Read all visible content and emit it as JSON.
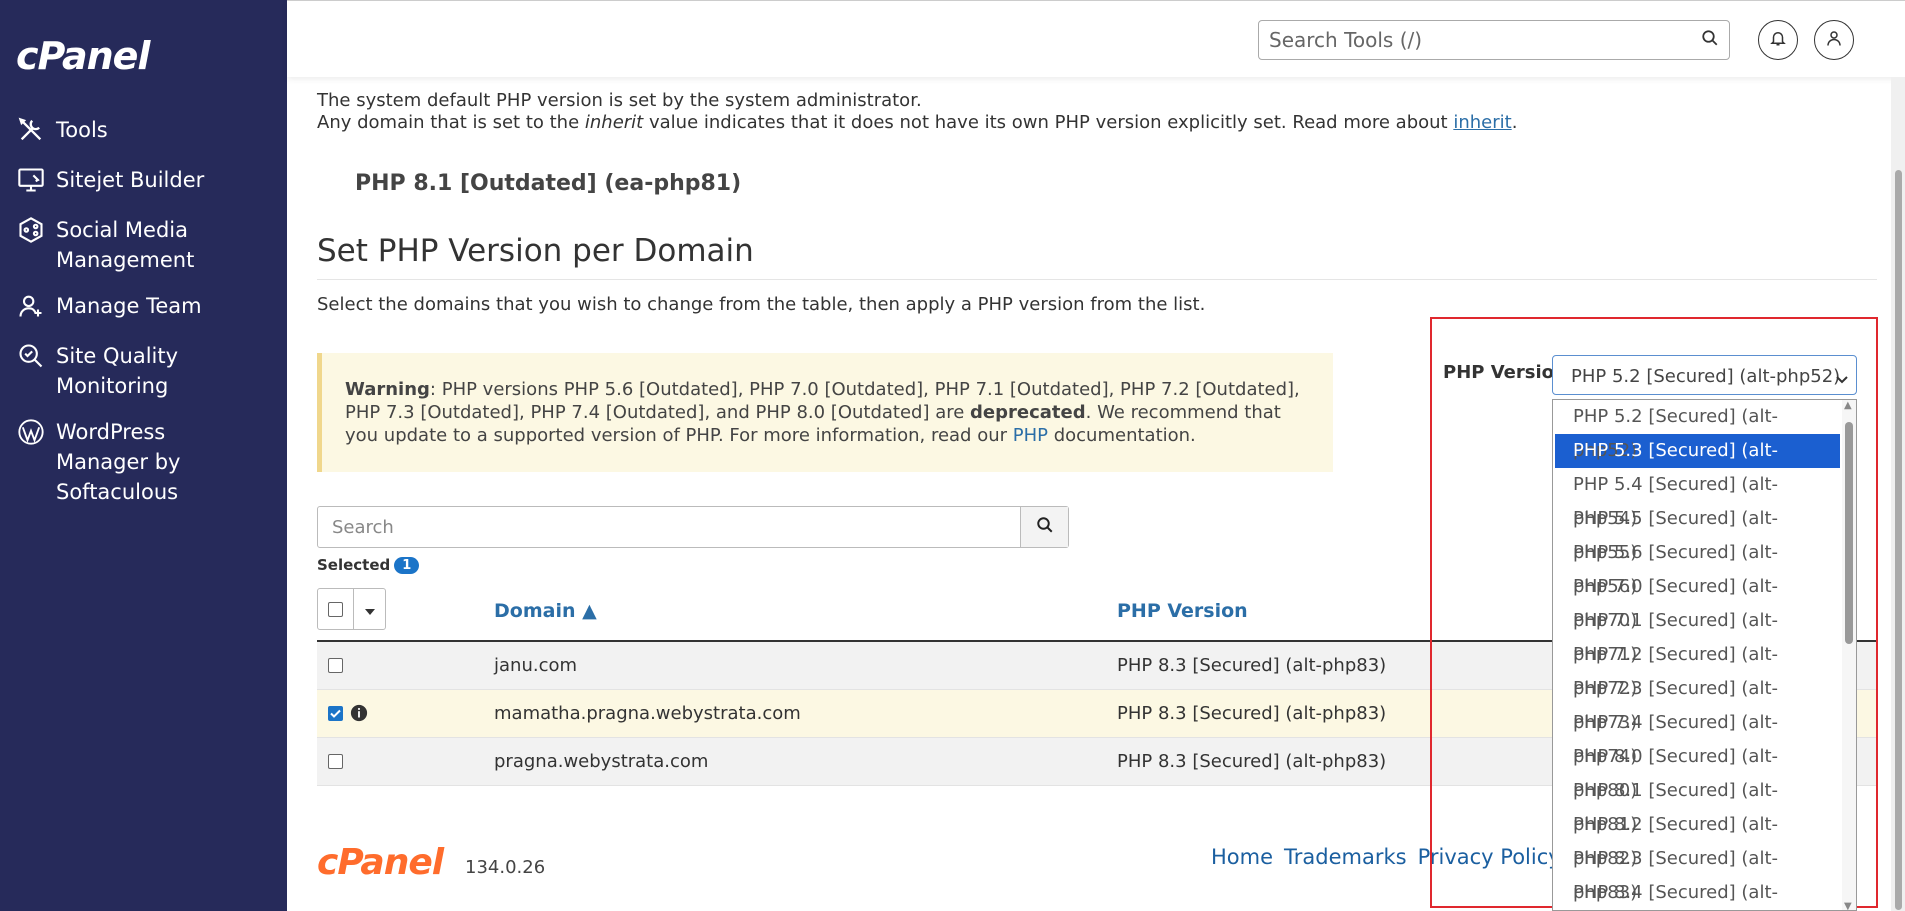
{
  "sidebar": {
    "logo": "cPanel",
    "items": [
      {
        "label": "Tools",
        "icon": "tools-icon"
      },
      {
        "label": "Sitejet Builder",
        "icon": "monitor-icon"
      },
      {
        "label": "Social Media Management",
        "icon": "social-icon"
      },
      {
        "label": "Manage Team",
        "icon": "team-icon"
      },
      {
        "label": "Site Quality Monitoring",
        "icon": "magnifier-icon"
      },
      {
        "label": "WordPress Manager by Softaculous",
        "icon": "wordpress-icon"
      }
    ]
  },
  "topbar": {
    "search_placeholder": "Search Tools (/)",
    "icons": [
      "search-icon",
      "bell-icon",
      "user-icon"
    ]
  },
  "intro": {
    "line1": "The system default PHP version is set by the system administrator.",
    "line2_a": "Any domain that is set to the ",
    "line2_em": "inherit",
    "line2_b": " value indicates that it does not have its own PHP version explicitly set. Read more about ",
    "line2_link": "inherit",
    "line2_end": "."
  },
  "current_version": "PHP 8.1 [Outdated] (ea-php81)",
  "section": {
    "title": "Set PHP Version per Domain",
    "description": "Select the domains that you wish to change from the table, then apply a PHP version from the list."
  },
  "warning": {
    "label": "Warning",
    "text_a": ": PHP versions PHP 5.6 [Outdated], PHP 7.0 [Outdated], PHP 7.1 [Outdated], PHP 7.2 [Outdated], PHP 7.3 [Outdated], PHP 7.4 [Outdated], and PHP 8.0 [Outdated] are ",
    "bold": "deprecated",
    "text_b": ". We recommend that you update to a supported version of PHP. For more information, read our ",
    "link": "PHP",
    "text_c": " documentation."
  },
  "table": {
    "search_placeholder": "Search",
    "selected_label": "Selected",
    "selected_count": "1",
    "columns": {
      "domain": "Domain ▲",
      "php": "PHP Version"
    },
    "rows": [
      {
        "domain": "janu.com",
        "php": "PHP 8.3 [Secured] (alt-php83)",
        "checked": false
      },
      {
        "domain": "mamatha.pragna.webystrata.com",
        "php": "PHP 8.3 [Secured] (alt-php83)",
        "checked": true
      },
      {
        "domain": "pragna.webystrata.com",
        "php": "PHP 8.3 [Secured] (alt-php83)",
        "checked": false
      }
    ]
  },
  "php_select": {
    "label": "PHP Version",
    "selected": "PHP 5.2 [Secured] (alt-php52)",
    "highlighted_index": 1,
    "options": [
      "PHP 5.2 [Secured] (alt-php52)",
      "PHP 5.3 [Secured] (alt-php53)",
      "PHP 5.4 [Secured] (alt-php54)",
      "PHP 5.5 [Secured] (alt-php55)",
      "PHP 5.6 [Secured] (alt-php56)",
      "PHP 7.0 [Secured] (alt-php70)",
      "PHP 7.1 [Secured] (alt-php71)",
      "PHP 7.2 [Secured] (alt-php72)",
      "PHP 7.3 [Secured] (alt-php73)",
      "PHP 7.4 [Secured] (alt-php74)",
      "PHP 8.0 [Secured] (alt-php80)",
      "PHP 8.1 [Secured] (alt-php81)",
      "PHP 8.2 [Secured] (alt-php82)",
      "PHP 8.3 [Secured] (alt-php83)",
      "PHP 8.4 [Secured] (alt-php84)"
    ]
  },
  "footer": {
    "logo": "cPanel",
    "version": "134.0.26",
    "links": [
      "Home",
      "Trademarks",
      "Privacy Policy"
    ]
  },
  "colors": {
    "sidebar_bg": "#262a5a",
    "link": "#2b6ea7",
    "accent": "#1b74c8",
    "brand_orange": "#ff6c2c",
    "highlight_frame": "#e0282e"
  }
}
